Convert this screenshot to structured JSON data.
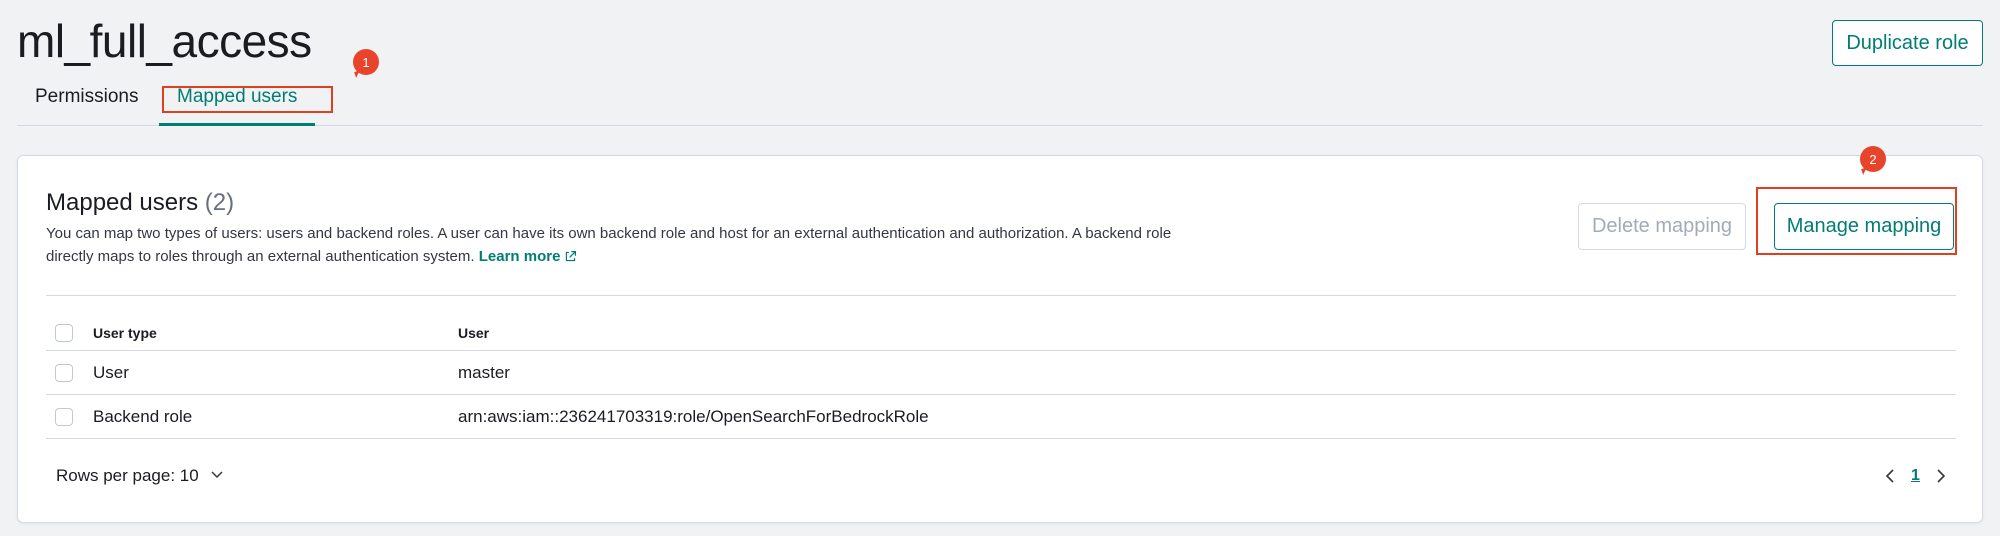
{
  "header": {
    "role_name": "ml_full_access",
    "duplicate_label": "Duplicate role"
  },
  "tabs": [
    {
      "label": "Permissions"
    },
    {
      "label": "Mapped users"
    }
  ],
  "markers": [
    "1",
    "2"
  ],
  "panel": {
    "title": "Mapped users",
    "count": "(2)",
    "description": "You can map two types of users: users and backend roles. A user can have its own backend role and host for an external authentication and authorization. A backend role directly maps to roles through an external authentication system.",
    "learn_more": "Learn more",
    "delete_label": "Delete mapping",
    "manage_label": "Manage mapping"
  },
  "table": {
    "columns": [
      "User type",
      "User"
    ],
    "rows": [
      {
        "type": "User",
        "user": "master"
      },
      {
        "type": "Backend role",
        "user": "arn:aws:iam::236241703319:role/OpenSearchForBedrockRole"
      }
    ]
  },
  "pagination": {
    "rows_per_page": "Rows per page: 10",
    "current_page": "1"
  },
  "colors": {
    "accent": "#017d73",
    "marker": "#e8442b"
  }
}
